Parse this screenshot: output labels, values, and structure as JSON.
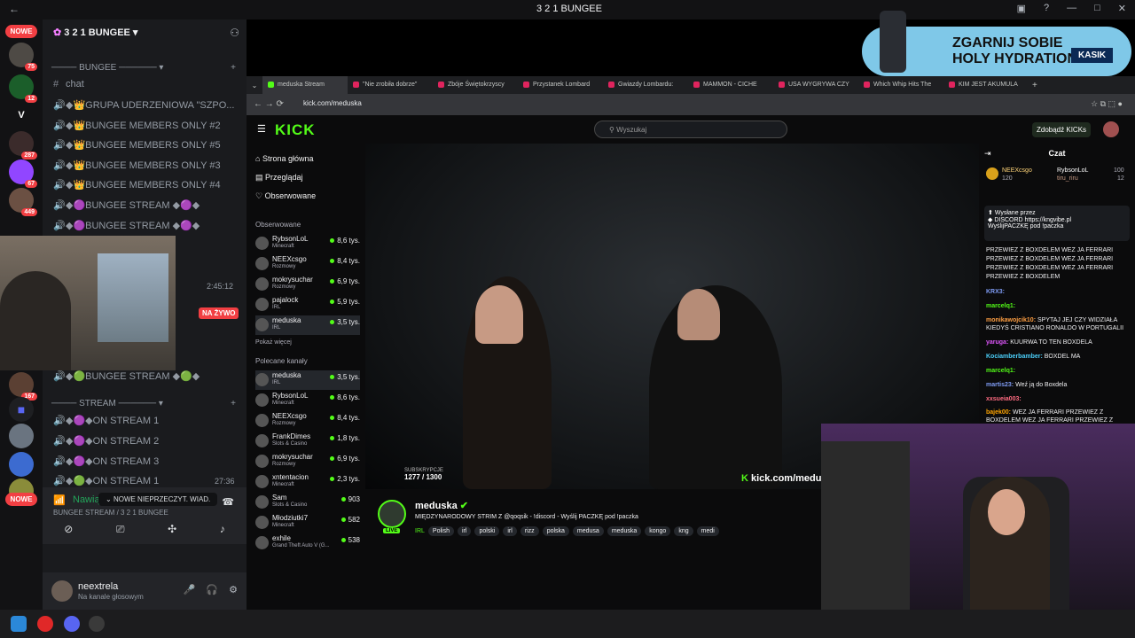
{
  "window": {
    "title": "3 2 1 BUNGEE"
  },
  "servers": [
    {
      "badge": "75"
    },
    {
      "badge": "12"
    },
    {
      "letter": "V"
    },
    {
      "badge": "287"
    },
    {
      "badge": "67"
    },
    {
      "badge": "449"
    },
    {
      "badge": "167"
    }
  ],
  "server_new_label": "NOWE",
  "discord": {
    "server_name": "3 2 1 BUNGEE",
    "category_bungee": "BUNGEE",
    "channels": [
      {
        "label": "chat"
      },
      {
        "label": "GRUPA UDERZENIOWA \"SZPO..."
      },
      {
        "label": "BUNGEE MEMBERS ONLY #2"
      },
      {
        "label": "BUNGEE MEMBERS ONLY #5"
      },
      {
        "label": "BUNGEE MEMBERS ONLY #3"
      },
      {
        "label": "BUNGEE MEMBERS ONLY #4"
      },
      {
        "label": "BUNGEE STREAM"
      },
      {
        "label": "BUNGEE STREAM"
      }
    ],
    "stream_timer": "2:45:12",
    "live_badge": "NA ŻYWO",
    "lower_channel": "BUNGEE STREAM",
    "category_stream": "STREAM",
    "stream_channels": [
      {
        "label": "ON STREAM 1"
      },
      {
        "label": "ON STREAM 2"
      },
      {
        "label": "ON STREAM 3"
      },
      {
        "label": "ON STREAM 1",
        "time": "27:36"
      }
    ],
    "tooltip": "NOWE NIEPRZECZYT. WIAD.",
    "connection": {
      "status": "Nawiązano połączenie",
      "detail": "BUNGEE STREAM / 3 2 1 BUNGEE"
    },
    "user": {
      "name": "neextrela",
      "status": "Na kanale głosowym"
    }
  },
  "banner": {
    "line1": "ZGARNIJ SOBIE",
    "line2": "HOLY HYDRATION",
    "code": "KASIK"
  },
  "browser": {
    "tabs": [
      {
        "label": "meduska Stream"
      },
      {
        "label": "\"Nie zrobiła dobrze\""
      },
      {
        "label": "Zbóje Świętokrzyscy"
      },
      {
        "label": "Przystanek Lombard"
      },
      {
        "label": "Gwiazdy Lombardu:"
      },
      {
        "label": "MAMMON - CICHE"
      },
      {
        "label": "USA WYGRYWA CZY"
      },
      {
        "label": "Which Whip Hits The"
      },
      {
        "label": "KIM JEST AKUMULA"
      }
    ],
    "url": "kick.com/meduska"
  },
  "kick": {
    "logo": "KICK",
    "search_placeholder": "Wyszukaj",
    "get_kicks": "Zdobądź KICKs",
    "nav": [
      "Strona główna",
      "Przeglądaj",
      "Obserwowane"
    ],
    "followed_title": "Obserwowane",
    "followed": [
      {
        "name": "RybsonLoL",
        "cat": "Minecraft",
        "viewers": "8,6 tys."
      },
      {
        "name": "NEEXcsgo",
        "cat": "Rozmowy",
        "viewers": "8,4 tys."
      },
      {
        "name": "mokrysuchar",
        "cat": "Rozmowy",
        "viewers": "6,9 tys."
      },
      {
        "name": "pajalock",
        "cat": "IRL",
        "viewers": "5,9 tys."
      },
      {
        "name": "meduska",
        "cat": "IRL",
        "viewers": "3,5 tys."
      }
    ],
    "show_more": "Pokaż więcej",
    "recommended_title": "Polecane kanały",
    "recommended": [
      {
        "name": "meduska",
        "cat": "IRL",
        "viewers": "3,5 tys."
      },
      {
        "name": "RybsonLoL",
        "cat": "Minecraft",
        "viewers": "8,6 tys."
      },
      {
        "name": "NEEXcsgo",
        "cat": "Rozmowy",
        "viewers": "8,4 tys."
      },
      {
        "name": "FrankDimes",
        "cat": "Slots & Casino",
        "viewers": "1,8 tys."
      },
      {
        "name": "mokrysuchar",
        "cat": "Rozmowy",
        "viewers": "6,9 tys."
      },
      {
        "name": "xntentacion",
        "cat": "Minecraft",
        "viewers": "2,3 tys."
      },
      {
        "name": "Sam",
        "cat": "Slots & Casino",
        "viewers": "903"
      },
      {
        "name": "Młodziutki7",
        "cat": "Minecraft",
        "viewers": "582"
      },
      {
        "name": "exhile",
        "cat": "Grand Theft Auto V (G...",
        "viewers": "538"
      }
    ],
    "overlay_url": "kick.com/meduska",
    "subs_label": "SUBSKRYPCJE",
    "subs_value": "1277 / 1300",
    "streamer": "meduska",
    "live_label": "LIVE",
    "stream_title": "MIĘDZYNARODOWY STRIM Z @qoqsik - !discord - Wyślij PACZKĘ pod !paczka",
    "category": "IRL",
    "tags": [
      "Polish",
      "irl",
      "polski",
      "irl",
      "rizz",
      "polska",
      "medusa",
      "meduska",
      "kongo",
      "kng",
      "medi"
    ]
  },
  "chat": {
    "title": "Czat",
    "gifters": [
      {
        "name": "NEEXcsgo",
        "amount": "120"
      },
      {
        "name": "RybsonLoL",
        "amount": "100"
      },
      {
        "name": "tiru_riru",
        "amount": "12"
      }
    ],
    "pinned_by": "Wysłane przez",
    "pinned_line1": "DISCORD https://kngvibe.pl",
    "pinned_line2": "WyślijPACZKĘ pod !paczka",
    "messages": [
      {
        "user": "",
        "text": "PRZEWIEZ Z BOXDELEM WEZ JA FERRARI"
      },
      {
        "user": "",
        "text": "PRZEWIEZ Z BOXDELEM WEZ JA FERRARI"
      },
      {
        "user": "",
        "text": "PRZEWIEZ Z BOXDELEM WEZ JA FERRARI"
      },
      {
        "user": "",
        "text": "PRZEWIEZ Z BOXDELEM"
      },
      {
        "user": "KRX3:",
        "text": ""
      },
      {
        "user": "marcelq1:",
        "text": ""
      },
      {
        "user": "monikawojcik10:",
        "text": "SPYTAJ JEJ CZY WIDZIAŁA KIEDYŚ CRISTIANO RONALDO W PORTUGALII"
      },
      {
        "user": "yaruga:",
        "text": "KUURWA TO TEN BOXDELA"
      },
      {
        "user": "Kociamberbamber:",
        "text": "BOXDEL MA"
      },
      {
        "user": "marcelq1:",
        "text": ""
      },
      {
        "user": "martis23:",
        "text": "Weź ją do Boxdela"
      },
      {
        "user": "xxsueia003:",
        "text": ""
      },
      {
        "user": "bajek00:",
        "text": "WEZ JA FERRARI PRZEWIEZ Z BOXDELEM WEZ JA FERRARI PRZEWIEZ Z"
      }
    ]
  },
  "colors": {
    "kick_green": "#53fc18",
    "discord_red": "#f23f43",
    "discord_green": "#23a55a"
  }
}
